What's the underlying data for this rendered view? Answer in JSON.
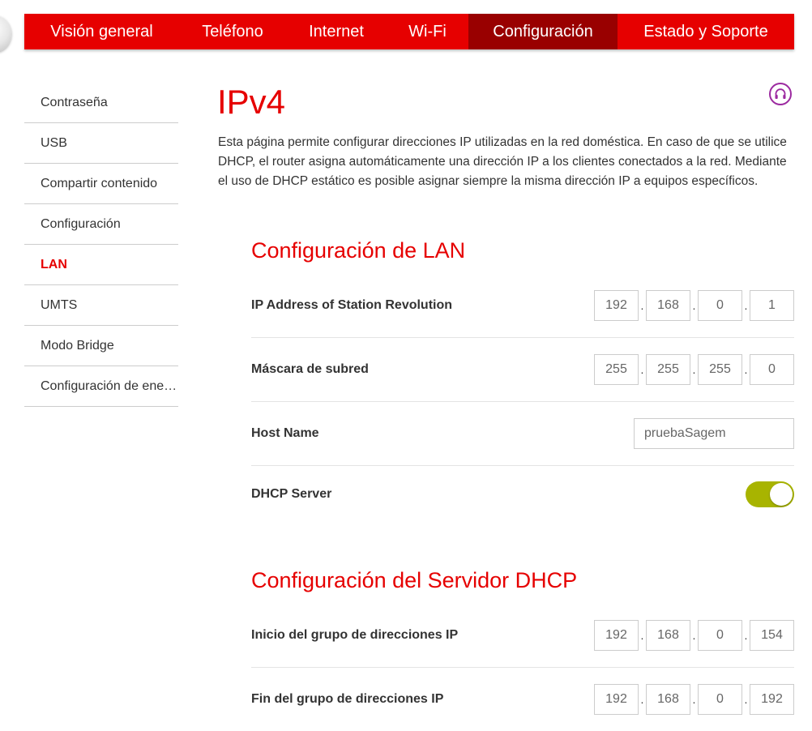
{
  "topnav": {
    "tabs": [
      {
        "label": "Visión general"
      },
      {
        "label": "Teléfono"
      },
      {
        "label": "Internet"
      },
      {
        "label": "Wi-Fi"
      },
      {
        "label": "Configuración",
        "active": true
      },
      {
        "label": "Estado y Soporte"
      }
    ]
  },
  "sidebar": {
    "items": [
      {
        "label": "Contraseña"
      },
      {
        "label": "USB"
      },
      {
        "label": "Compartir contenido"
      },
      {
        "label": "Configuración"
      },
      {
        "label": "LAN",
        "active": true
      },
      {
        "label": "UMTS"
      },
      {
        "label": "Modo Bridge"
      },
      {
        "label": "Configuración de energía"
      }
    ]
  },
  "page": {
    "title": "IPv4",
    "intro": "Esta página permite configurar direcciones IP utilizadas en la red doméstica. En caso de que se utilice DHCP, el router asigna automáticamente una dirección IP a los clientes conectados a la red. Mediante el uso de DHCP estático es posible asignar siempre la misma dirección IP a equipos específicos.",
    "help_icon": "refresh-help-icon"
  },
  "lan": {
    "title": "Configuración de LAN",
    "ip_address": {
      "label": "IP Address of Station Revolution",
      "octets": [
        "192",
        "168",
        "0",
        "1"
      ]
    },
    "subnet_mask": {
      "label": "Máscara de subred",
      "octets": [
        "255",
        "255",
        "255",
        "0"
      ]
    },
    "host_name": {
      "label": "Host Name",
      "value": "pruebaSagem"
    },
    "dhcp_server": {
      "label": "DHCP Server",
      "enabled": true
    }
  },
  "dhcp": {
    "title": "Configuración del Servidor DHCP",
    "pool_start": {
      "label": "Inicio del grupo de direcciones IP",
      "octets": [
        "192",
        "168",
        "0",
        "154"
      ]
    },
    "pool_end": {
      "label": "Fin del grupo de direcciones IP",
      "octets": [
        "192",
        "168",
        "0",
        "192"
      ]
    }
  },
  "colors": {
    "brand_red": "#e60000",
    "active_tab": "#990000",
    "toggle_on": "#a8b400",
    "help_purple": "#9c2aa0"
  }
}
